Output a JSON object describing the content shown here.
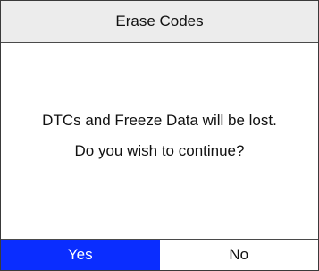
{
  "dialog": {
    "title": "Erase Codes",
    "message_lines": [
      "DTCs and Freeze Data will be lost.",
      "Do you wish to continue?"
    ]
  },
  "buttons": {
    "yes_label": "Yes",
    "no_label": "No",
    "selected": "yes"
  },
  "colors": {
    "title_bg": "#ececec",
    "selected_button_bg": "#0a2dff",
    "selected_button_text": "#ffffff"
  }
}
